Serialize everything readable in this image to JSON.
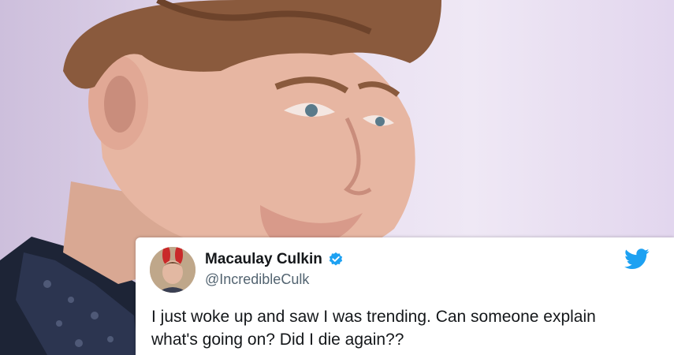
{
  "tweet": {
    "display_name": "Macaulay Culkin",
    "handle": "@IncredibleCulk",
    "text_line1": "I just woke up and saw I was trending. Can someone explain",
    "text_line2": "what's going on? Did I die again??",
    "verified": true
  },
  "colors": {
    "twitter_blue": "#1da1f2",
    "text": "#14171a",
    "handle_gray": "#536471",
    "background_lavender": "#e6dcef"
  },
  "icons": [
    "verified-badge-icon",
    "twitter-bird-icon"
  ]
}
